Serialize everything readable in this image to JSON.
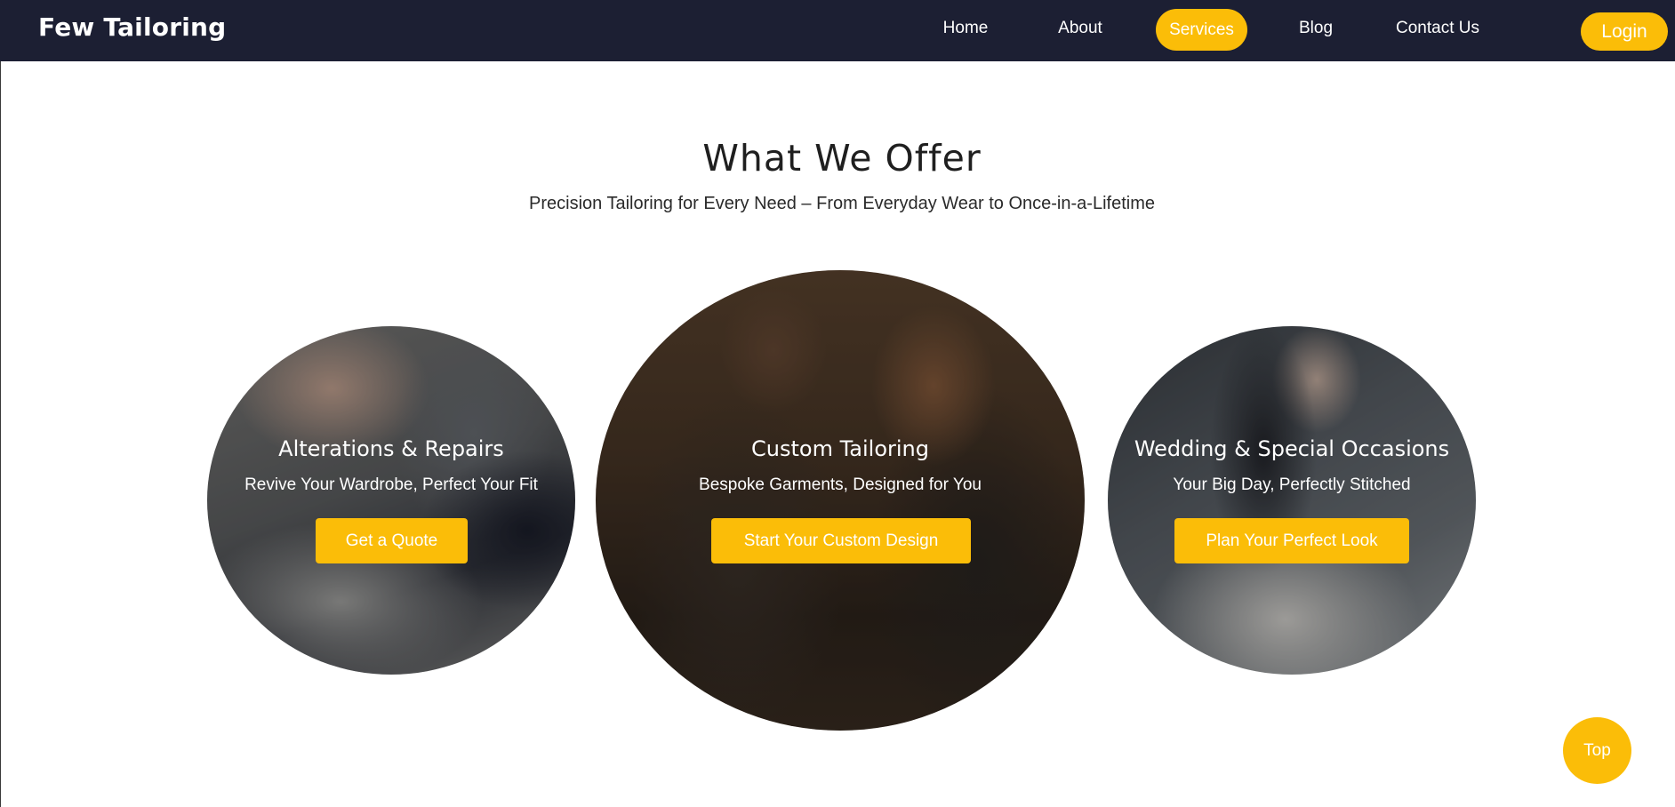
{
  "brand": "Few Tailoring",
  "nav": {
    "items": [
      {
        "label": "Home"
      },
      {
        "label": "About"
      },
      {
        "label": "Services",
        "active": true
      },
      {
        "label": "Blog"
      },
      {
        "label": "Contact Us"
      }
    ],
    "login_label": "Login"
  },
  "section": {
    "title": "What We Offer",
    "subtitle": "Precision Tailoring for Every Need – From Everyday Wear to Once-in-a-Lifetime"
  },
  "services": [
    {
      "title": "Alterations & Repairs",
      "subtitle": "Revive Your Wardrobe, Perfect Your Fit",
      "cta": "Get a Quote"
    },
    {
      "title": "Custom Tailoring",
      "subtitle": "Bespoke Garments, Designed for You",
      "cta": "Start Your Custom Design"
    },
    {
      "title": "Wedding & Special Occasions",
      "subtitle": "Your Big Day, Perfectly Stitched",
      "cta": "Plan Your Perfect Look"
    }
  ],
  "top_label": "Top",
  "colors": {
    "accent": "#fbbd08",
    "navbar": "#1c1f33"
  }
}
